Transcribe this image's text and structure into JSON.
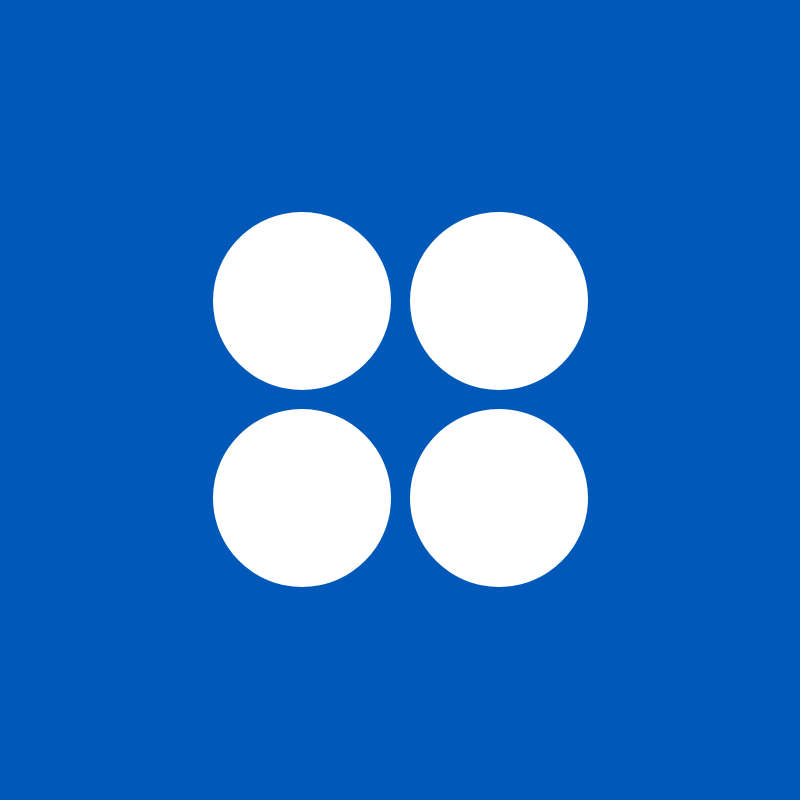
{
  "icon": {
    "name": "four-dots-grid-icon",
    "colors": {
      "background": "#0059B8",
      "dots": "#FFFFFF"
    },
    "dot_count": 4
  }
}
